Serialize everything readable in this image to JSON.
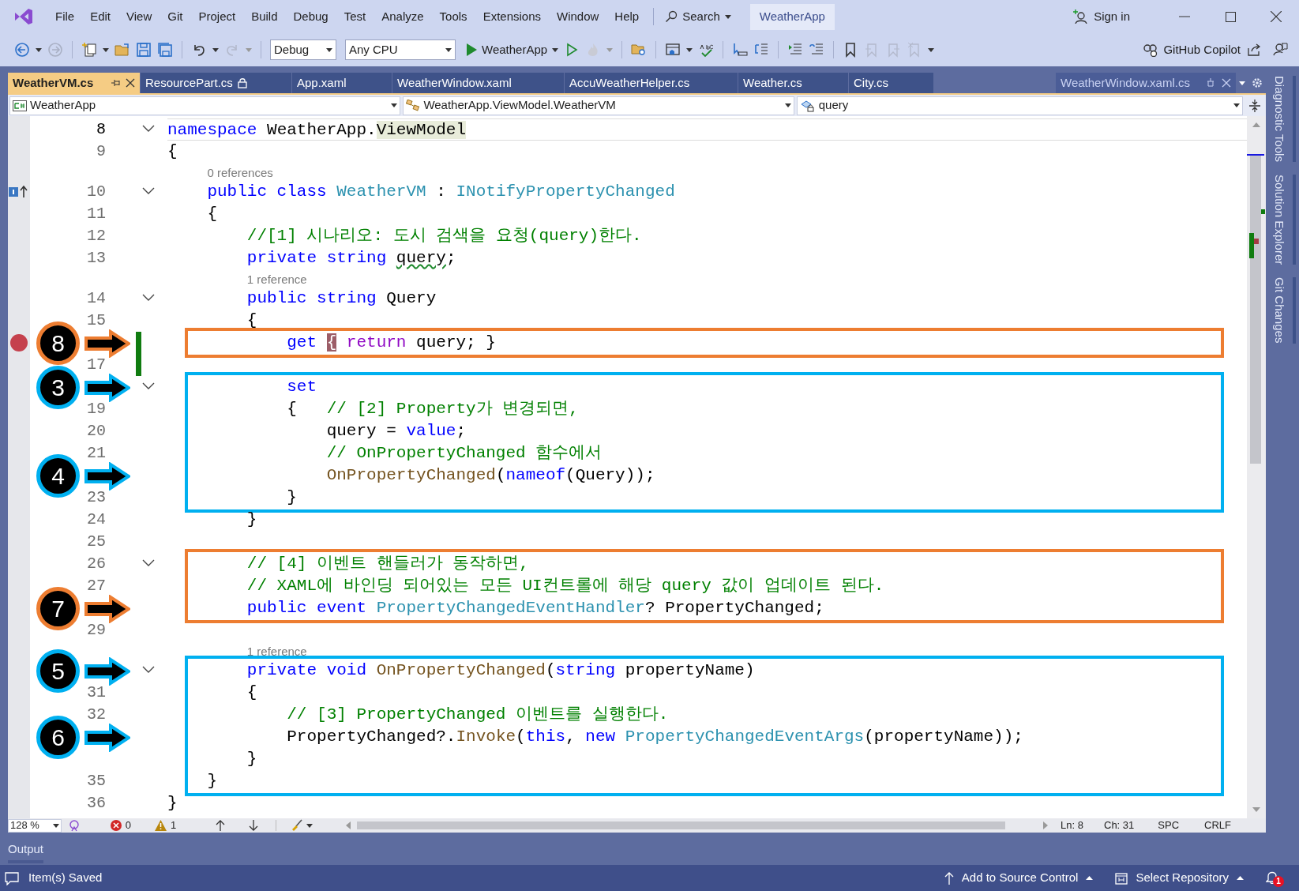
{
  "menu": [
    "File",
    "Edit",
    "View",
    "Git",
    "Project",
    "Build",
    "Debug",
    "Test",
    "Analyze",
    "Tools",
    "Extensions",
    "Window",
    "Help"
  ],
  "search": {
    "label": "Search"
  },
  "solution_title": "WeatherApp",
  "sign_in": "Sign in",
  "toolbar": {
    "configuration": "Debug",
    "platform": "Any CPU",
    "start_target": "WeatherApp",
    "copilot": "GitHub Copilot"
  },
  "tabs": [
    {
      "label": "WeatherVM.cs",
      "selected": true,
      "locked": false
    },
    {
      "label": "ResourcePart.cs",
      "selected": false,
      "locked": true
    },
    {
      "label": "App.xaml",
      "selected": false,
      "locked": false
    },
    {
      "label": "WeatherWindow.xaml",
      "selected": false,
      "locked": false
    },
    {
      "label": "AccuWeatherHelper.cs",
      "selected": false,
      "locked": false
    },
    {
      "label": "Weather.cs",
      "selected": false,
      "locked": false
    },
    {
      "label": "City.cs",
      "selected": false,
      "locked": false
    }
  ],
  "preview_tab": {
    "label": "WeatherWindow.xaml.cs"
  },
  "nav_bar": {
    "project": "WeatherApp",
    "type": "WeatherApp.ViewModel.WeatherVM",
    "member": "query"
  },
  "code_blocks": [
    {
      "lines": [
        {
          "kind": "code",
          "number": "8",
          "fold": true,
          "current": true,
          "tokens": [
            {
              "kind": "keyword",
              "text": "namespace"
            },
            {
              "kind": "plain",
              "text": " WeatherApp."
            },
            {
              "kind": "highlight",
              "text": "ViewModel"
            }
          ]
        },
        {
          "kind": "code",
          "number": "9",
          "fold": false,
          "tokens": [
            {
              "kind": "plain",
              "text": "{"
            }
          ]
        },
        {
          "kind": "codelens",
          "text": "0 references"
        },
        {
          "kind": "code",
          "number": "10",
          "fold": true,
          "inheritance": true,
          "tokens": [
            {
              "kind": "keyword",
              "text": "    public class "
            },
            {
              "kind": "type",
              "text": "WeatherVM"
            },
            {
              "kind": "plain",
              "text": " : "
            },
            {
              "kind": "type",
              "text": "INotifyPropertyChanged"
            }
          ]
        },
        {
          "kind": "code",
          "number": "11",
          "fold": false,
          "tokens": [
            {
              "kind": "plain",
              "text": "    {"
            }
          ]
        },
        {
          "kind": "code",
          "number": "12",
          "fold": false,
          "tokens": [
            {
              "kind": "comment",
              "text": "        //[1] 시나리오: 도시 검색을 요청(query)한다."
            }
          ]
        },
        {
          "kind": "code",
          "number": "13",
          "fold": false,
          "tokens": [
            {
              "kind": "keyword",
              "text": "        private string "
            },
            {
              "kind": "squiggle",
              "text": "query"
            },
            {
              "kind": "plain",
              "text": ";"
            }
          ]
        },
        {
          "kind": "codelens",
          "text": "1 reference"
        },
        {
          "kind": "code",
          "number": "14",
          "fold": true,
          "tokens": [
            {
              "kind": "keyword",
              "text": "        public string"
            },
            {
              "kind": "plain",
              "text": " Query"
            }
          ]
        },
        {
          "kind": "code",
          "number": "15",
          "fold": false,
          "tokens": [
            {
              "kind": "plain",
              "text": "        {"
            }
          ]
        }
      ]
    },
    {
      "box": {
        "color": "#ed7d31"
      },
      "lines": [
        {
          "kind": "code",
          "fold": false,
          "breakpoint": true,
          "changed": true,
          "callout": {
            "number": "8",
            "color": "#ed7d31"
          },
          "tokens": [
            {
              "kind": "keyword",
              "text": "            get "
            },
            {
              "kind": "brace",
              "text": "{"
            },
            {
              "kind": "control",
              "text": " return"
            },
            {
              "kind": "plain",
              "text": " query; }"
            }
          ]
        }
      ]
    },
    {
      "lines": [
        {
          "kind": "code",
          "number": "17",
          "fold": false,
          "changed": true
        }
      ]
    },
    {
      "box": {
        "color": "#00b0f0"
      },
      "lines": [
        {
          "kind": "code",
          "fold": true,
          "callout": {
            "number": "3",
            "color": "#00b0f0"
          },
          "tokens": [
            {
              "kind": "keyword",
              "text": "            set"
            }
          ]
        },
        {
          "kind": "code",
          "number": "19",
          "fold": false,
          "tokens": [
            {
              "kind": "plain",
              "text": "            {   "
            },
            {
              "kind": "comment",
              "text": "// [2] Property가 변경되면,"
            }
          ]
        },
        {
          "kind": "code",
          "number": "20",
          "fold": false,
          "tokens": [
            {
              "kind": "plain",
              "text": "                query = "
            },
            {
              "kind": "keyword",
              "text": "value"
            },
            {
              "kind": "plain",
              "text": ";"
            }
          ]
        },
        {
          "kind": "code",
          "number": "21",
          "fold": false,
          "tokens": [
            {
              "kind": "comment",
              "text": "                // OnPropertyChanged 함수에서"
            }
          ]
        },
        {
          "kind": "code",
          "fold": false,
          "callout": {
            "number": "4",
            "color": "#00b0f0"
          },
          "tokens": [
            {
              "kind": "method",
              "text": "                OnPropertyChanged"
            },
            {
              "kind": "plain",
              "text": "("
            },
            {
              "kind": "keyword",
              "text": "nameof"
            },
            {
              "kind": "plain",
              "text": "(Query));"
            }
          ]
        },
        {
          "kind": "code",
          "number": "23",
          "fold": false,
          "tokens": [
            {
              "kind": "plain",
              "text": "            }"
            }
          ]
        }
      ]
    },
    {
      "lines": [
        {
          "kind": "code",
          "number": "24",
          "fold": false,
          "tokens": [
            {
              "kind": "plain",
              "text": "        }"
            }
          ]
        },
        {
          "kind": "code",
          "number": "25",
          "fold": false
        }
      ]
    },
    {
      "box": {
        "color": "#ed7d31"
      },
      "lines": [
        {
          "kind": "code",
          "number": "26",
          "fold": true,
          "tokens": [
            {
              "kind": "comment",
              "text": "        // [4] 이벤트 핸들러가 동작하면,"
            }
          ]
        },
        {
          "kind": "code",
          "number": "27",
          "fold": false,
          "tokens": [
            {
              "kind": "comment",
              "text": "        // XAML에 바인딩 되어있는 모든 UI컨트롤에 해당 query 값이 업데이트 된다."
            }
          ]
        },
        {
          "kind": "code",
          "fold": false,
          "callout": {
            "number": "7",
            "color": "#ed7d31"
          },
          "tokens": [
            {
              "kind": "keyword",
              "text": "        public event "
            },
            {
              "kind": "type",
              "text": "PropertyChangedEventHandler"
            },
            {
              "kind": "plain",
              "text": "? PropertyChanged;"
            }
          ]
        }
      ]
    },
    {
      "lines": [
        {
          "kind": "code",
          "number": "29",
          "fold": false
        },
        {
          "kind": "codelens",
          "text": "1 reference"
        }
      ]
    },
    {
      "box": {
        "color": "#00b0f0"
      },
      "lines": [
        {
          "kind": "code",
          "fold": true,
          "callout": {
            "number": "5",
            "color": "#00b0f0"
          },
          "tokens": [
            {
              "kind": "keyword",
              "text": "        private void "
            },
            {
              "kind": "method",
              "text": "OnPropertyChanged"
            },
            {
              "kind": "plain",
              "text": "("
            },
            {
              "kind": "keyword",
              "text": "string"
            },
            {
              "kind": "plain",
              "text": " propertyName)"
            }
          ]
        },
        {
          "kind": "code",
          "number": "31",
          "fold": false,
          "tokens": [
            {
              "kind": "plain",
              "text": "        {"
            }
          ]
        },
        {
          "kind": "code",
          "number": "32",
          "fold": false,
          "tokens": [
            {
              "kind": "comment",
              "text": "            // [3] PropertyChanged 이벤트를 실행한다."
            }
          ]
        },
        {
          "kind": "code",
          "fold": false,
          "callout": {
            "number": "6",
            "color": "#00b0f0"
          },
          "tokens": [
            {
              "kind": "plain",
              "text": "            PropertyChanged?."
            },
            {
              "kind": "method",
              "text": "Invoke"
            },
            {
              "kind": "plain",
              "text": "("
            },
            {
              "kind": "keyword",
              "text": "this"
            },
            {
              "kind": "plain",
              "text": ", "
            },
            {
              "kind": "keyword",
              "text": "new "
            },
            {
              "kind": "type",
              "text": "PropertyChangedEventArgs"
            },
            {
              "kind": "plain",
              "text": "(propertyName));"
            }
          ]
        },
        {
          "kind": "code",
          "fold": false,
          "tokens": [
            {
              "kind": "plain",
              "text": "        }"
            }
          ]
        },
        {
          "kind": "code",
          "number": "35",
          "fold": false,
          "tokens": [
            {
              "kind": "plain",
              "text": "    }"
            }
          ]
        }
      ]
    },
    {
      "lines": [
        {
          "kind": "code",
          "number": "36",
          "fold": false,
          "tokens": [
            {
              "kind": "plain",
              "text": "}"
            }
          ]
        }
      ]
    }
  ],
  "editor_status": {
    "zoom": "128 %",
    "errors": "0",
    "warnings": "1",
    "line": "Ln: 8",
    "column": "Ch: 31",
    "whitespace": "SPC",
    "line_endings": "CRLF"
  },
  "output_panel": {
    "title": "Output"
  },
  "side_tabs": [
    "Diagnostic Tools",
    "Solution Explorer",
    "Git Changes"
  ],
  "status_bar": {
    "message": "Item(s) Saved",
    "source_control": "Add to Source Control",
    "repository": "Select Repository",
    "notifications": "1"
  }
}
